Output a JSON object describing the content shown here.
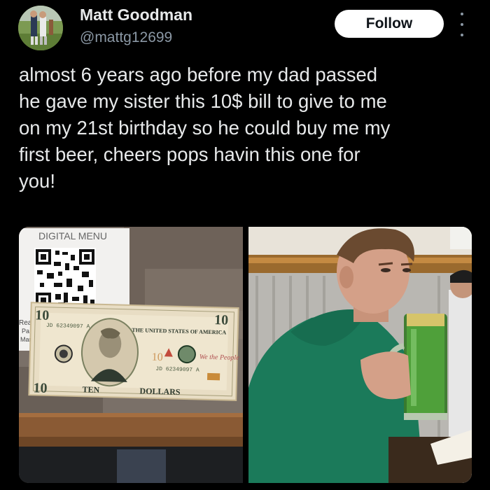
{
  "author": {
    "name": "Matt Goodman",
    "handle": "@mattg12699"
  },
  "follow_label": "Follow",
  "tweet_text": "almost 6 years ago before my dad passed\nhe gave my sister this 10$ bill to give to me\non my 21st birthday so he could buy me my\nfirst beer, cheers pops havin this one for\nyou!",
  "media": {
    "left_photo": {
      "menu_card_text": "DIGITAL MENU",
      "bill_serial": "JD 62349097 A",
      "bill_top_text": "THE UNITED STATES OF AMERICA",
      "bill_bottom_text": "TEN",
      "bill_bottom_right_text": "DOLLARS",
      "bill_denomination": "10",
      "bill_we_the_people": "We the People",
      "side_labels": [
        "Read",
        "Pa",
        "Man"
      ]
    },
    "right_photo": {}
  },
  "colors": {
    "background": "#000000",
    "primary_text": "#e7e9ea",
    "secondary_text": "#8b98a5",
    "follow_bg": "#ffffff"
  }
}
